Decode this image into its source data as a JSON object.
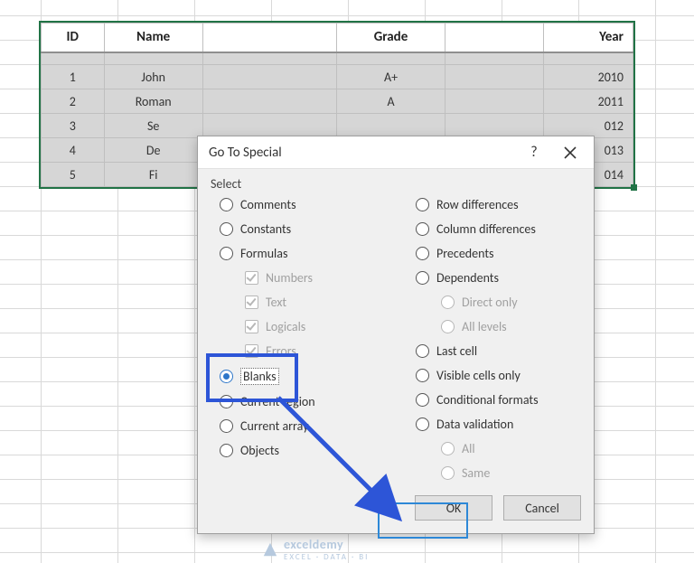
{
  "table": {
    "headers": [
      "ID",
      "Name",
      "",
      "Grade",
      "",
      "Year"
    ],
    "rows": [
      {
        "id": "1",
        "name": "John",
        "grade": "A+",
        "year": "2010"
      },
      {
        "id": "2",
        "name": "Roman",
        "grade": "A",
        "year": "2011"
      },
      {
        "id": "3",
        "name": "Se",
        "grade": "",
        "year": "012"
      },
      {
        "id": "4",
        "name": "De",
        "grade": "",
        "year": "013"
      },
      {
        "id": "5",
        "name": "Fi",
        "grade": "",
        "year": "014"
      }
    ]
  },
  "dialog": {
    "title": "Go To Special",
    "group": "Select",
    "left": {
      "comments": "Comments",
      "constants": "Constants",
      "formulas": "Formulas",
      "numbers": "Numbers",
      "text": "Text",
      "logicals": "Logicals",
      "errors": "Errors",
      "blanks": "Blanks",
      "current_region": "Current region",
      "current_array": "Current array",
      "objects": "Objects"
    },
    "right": {
      "row_diff": "Row differences",
      "col_diff": "Column differences",
      "precedents": "Precedents",
      "dependents": "Dependents",
      "direct_only": "Direct only",
      "all_levels": "All levels",
      "last_cell": "Last cell",
      "visible_only": "Visible cells only",
      "cond_formats": "Conditional formats",
      "data_validation": "Data validation",
      "all": "All",
      "same": "Same"
    },
    "buttons": {
      "ok": "OK",
      "cancel": "Cancel"
    },
    "help": "?"
  },
  "watermark": {
    "brand": "exceldemy",
    "tag": "EXCEL · DATA · BI"
  }
}
